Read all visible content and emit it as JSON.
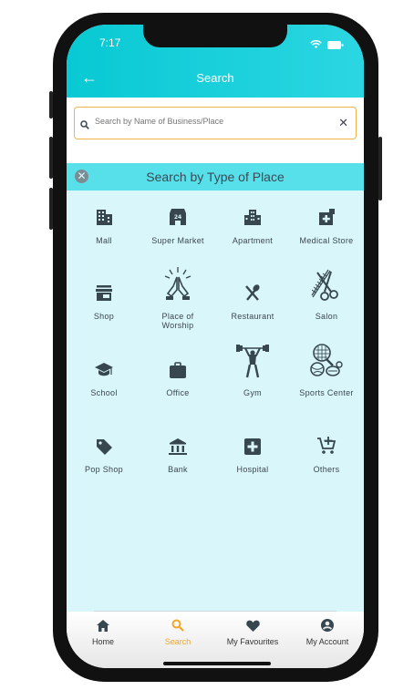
{
  "status": {
    "time": "7:17"
  },
  "header": {
    "title": "Search"
  },
  "search": {
    "placeholder": "Search by Name of Business/Place",
    "value": ""
  },
  "panel": {
    "title": "Search by Type of Place"
  },
  "places": [
    {
      "label": "Mall",
      "icon": "building-icon"
    },
    {
      "label": "Super Market",
      "icon": "store-24-icon"
    },
    {
      "label": "Apartment",
      "icon": "apartment-icon"
    },
    {
      "label": "Medical Store",
      "icon": "medical-store-icon"
    },
    {
      "label": "Shop",
      "icon": "shop-icon"
    },
    {
      "label": "Place of Worship",
      "icon": "worship-hands-icon"
    },
    {
      "label": "Restaurant",
      "icon": "fork-spoon-icon"
    },
    {
      "label": "Salon",
      "icon": "scissors-comb-icon"
    },
    {
      "label": "School",
      "icon": "graduation-cap-icon"
    },
    {
      "label": "Office",
      "icon": "briefcase-icon"
    },
    {
      "label": "Gym",
      "icon": "weightlifter-icon"
    },
    {
      "label": "Sports Center",
      "icon": "sports-balls-icon"
    },
    {
      "label": "Pop Shop",
      "icon": "tag-icon"
    },
    {
      "label": "Bank",
      "icon": "bank-icon"
    },
    {
      "label": "Hospital",
      "icon": "hospital-cross-icon"
    },
    {
      "label": "Others",
      "icon": "cart-plus-icon"
    }
  ],
  "nav": [
    {
      "label": "Home",
      "icon": "home-icon"
    },
    {
      "label": "Search",
      "icon": "search-icon",
      "active": true
    },
    {
      "label": "My Favourites",
      "icon": "heart-icon"
    },
    {
      "label": "My Account",
      "icon": "account-icon"
    }
  ],
  "colors": {
    "header": "#08c9d3",
    "panel": "#d9f6fa",
    "panel_header": "#57e0ea",
    "accent": "#f5a623",
    "icon": "#37474f"
  }
}
